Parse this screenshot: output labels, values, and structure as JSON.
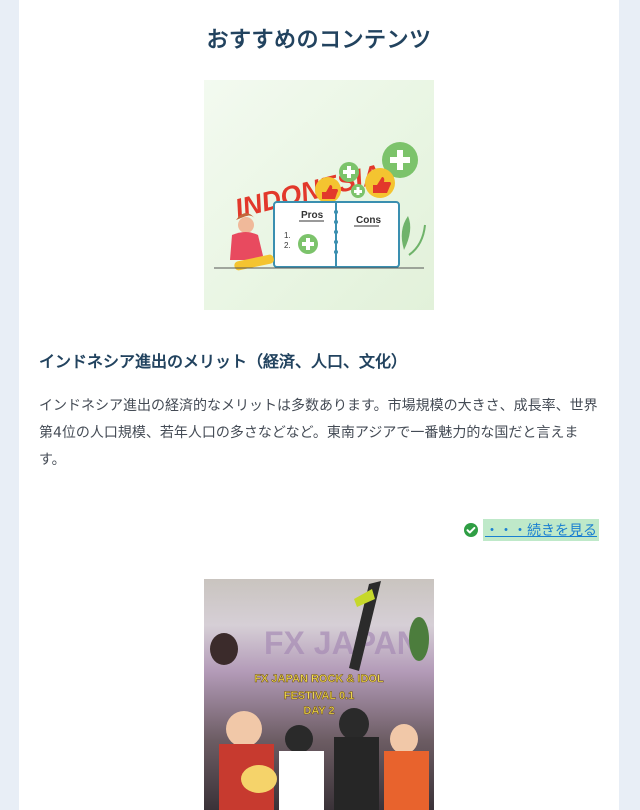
{
  "section": {
    "title": "おすすめのコンテンツ"
  },
  "article": {
    "title": "インドネシア進出のメリット（経済、人口、文化）",
    "body": "インドネシア進出の経済的なメリットは多数あります。市場規模の大きさ、成長率、世界第4位の人口規模、若年人口の多さなどなど。東南アジアで一番魅力的な国だと言えます。",
    "read_more": "・・・続きを見る",
    "image": {
      "word": "INDONESIA",
      "pros": "Pros",
      "cons": "Cons",
      "list_1": "1.",
      "list_2": "2.",
      "icon": "indonesia-pros-cons-illustration"
    }
  },
  "next_article": {
    "image": {
      "line1": "FX JAPAN ROCK & IDOL",
      "line2": "FESTIVAL 0.1",
      "line3": "DAY 2",
      "backdrop": "FX JAPAN"
    }
  },
  "colors": {
    "page_bg": "#e8eef6",
    "title": "#22435f",
    "link": "#1a7fd1",
    "link_highlight": "#bfe9c9",
    "check": "#2f9e44"
  }
}
